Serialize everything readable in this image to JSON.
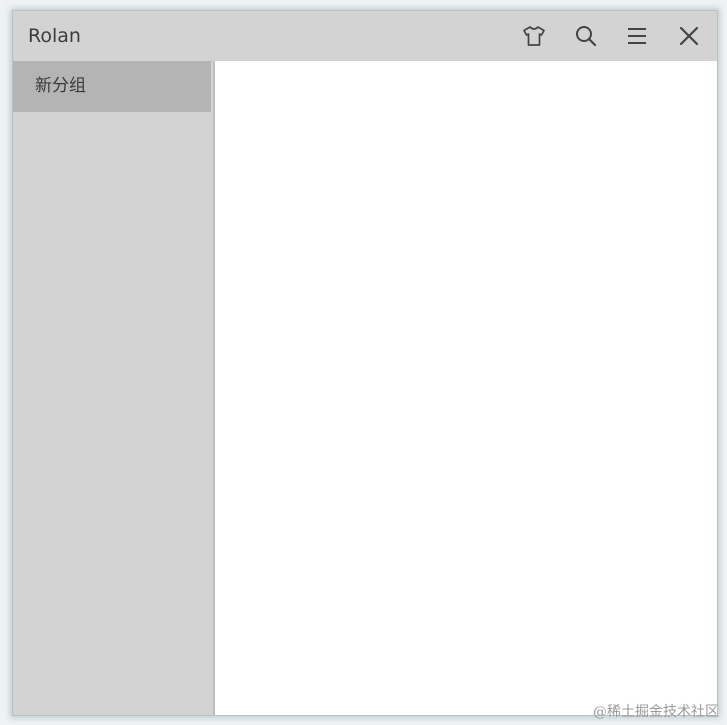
{
  "window": {
    "title": "Rolan"
  },
  "titlebar": {
    "buttons": [
      {
        "icon": "shirt-icon",
        "name": "skin-button"
      },
      {
        "icon": "search-icon",
        "name": "search-button"
      },
      {
        "icon": "menu-icon",
        "name": "menu-button"
      },
      {
        "icon": "close-icon",
        "name": "close-button"
      }
    ]
  },
  "sidebar": {
    "items": [
      {
        "label": "新分组",
        "selected": true
      }
    ]
  },
  "watermark": {
    "text": "@稀土掘金技术社区"
  },
  "colors": {
    "titlebar_bg": "#d3d3d3",
    "sidebar_bg": "#d3d3d3",
    "selected_item_bg": "#b4b4b4",
    "content_bg": "#ffffff",
    "icon_color": "#444444"
  }
}
